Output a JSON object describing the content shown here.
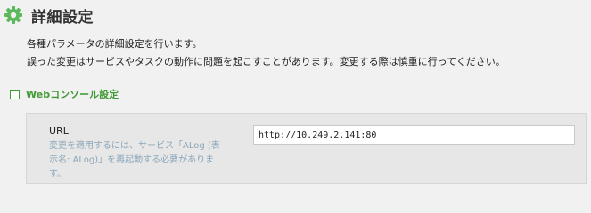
{
  "header": {
    "title": "詳細設定",
    "icon": "gear-icon"
  },
  "description": {
    "line1": "各種パラメータの詳細設定を行います。",
    "line2": "誤った変更はサービスやタスクの動作に問題を起こすことがあります。変更する際は慎重に行ってください。"
  },
  "section": {
    "label": "Webコンソール設定"
  },
  "url_field": {
    "label": "URL",
    "help": "変更を適用するには、サービス「ALog (表示名: ALog)」を再起動する必要があります。",
    "value": "http://10.249.2.141:80"
  },
  "colors": {
    "accent": "#3e9a34",
    "help_text": "#8aa6ba",
    "background": "#f1f1f1"
  }
}
